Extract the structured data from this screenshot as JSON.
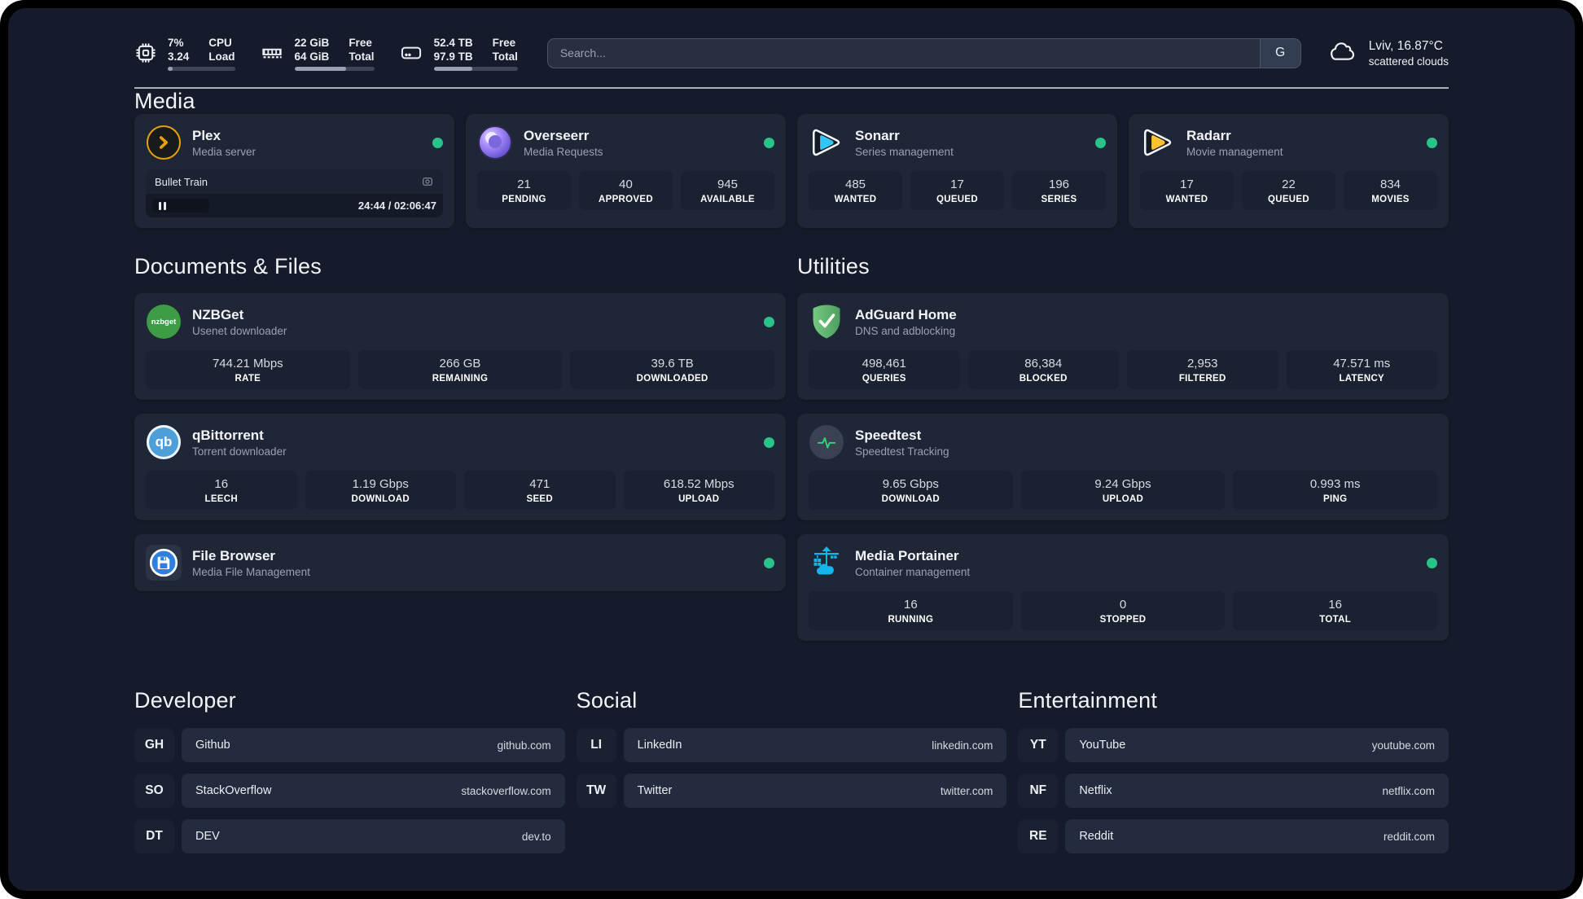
{
  "header": {
    "stats": [
      {
        "name": "cpu",
        "values": [
          "7%",
          "3.24"
        ],
        "labels": [
          "CPU",
          "Load"
        ],
        "percent": 7
      },
      {
        "name": "memory",
        "values": [
          "22 GiB",
          "64 GiB"
        ],
        "labels": [
          "Free",
          "Total"
        ],
        "percent": 65
      },
      {
        "name": "disk",
        "values": [
          "52.4 TB",
          "97.9 TB"
        ],
        "labels": [
          "Free",
          "Total"
        ],
        "percent": 46
      }
    ],
    "search": {
      "placeholder": "Search...",
      "engine": "G"
    },
    "weather": {
      "summary": "Lviv, 16.87°C",
      "condition": "scattered clouds"
    }
  },
  "media": {
    "title": "Media",
    "plex": {
      "name": "Plex",
      "subtitle": "Media server",
      "player": {
        "title": "Bullet Train",
        "time": "24:44 / 02:06:47",
        "progress_percent": 20,
        "state": "paused"
      }
    },
    "overseerr": {
      "name": "Overseerr",
      "subtitle": "Media Requests",
      "stats": [
        {
          "value": "21",
          "label": "PENDING"
        },
        {
          "value": "40",
          "label": "APPROVED"
        },
        {
          "value": "945",
          "label": "AVAILABLE"
        }
      ]
    },
    "sonarr": {
      "name": "Sonarr",
      "subtitle": "Series management",
      "stats": [
        {
          "value": "485",
          "label": "WANTED"
        },
        {
          "value": "17",
          "label": "QUEUED"
        },
        {
          "value": "196",
          "label": "SERIES"
        }
      ]
    },
    "radarr": {
      "name": "Radarr",
      "subtitle": "Movie management",
      "stats": [
        {
          "value": "17",
          "label": "WANTED"
        },
        {
          "value": "22",
          "label": "QUEUED"
        },
        {
          "value": "834",
          "label": "MOVIES"
        }
      ]
    }
  },
  "documents": {
    "title": "Documents & Files",
    "nzbget": {
      "name": "NZBGet",
      "subtitle": "Usenet downloader",
      "icon_text": "nzbget",
      "stats": [
        {
          "value": "744.21 Mbps",
          "label": "RATE"
        },
        {
          "value": "266 GB",
          "label": "REMAINING"
        },
        {
          "value": "39.6 TB",
          "label": "DOWNLOADED"
        }
      ]
    },
    "qbittorrent": {
      "name": "qBittorrent",
      "subtitle": "Torrent downloader",
      "icon_text": "qb",
      "stats": [
        {
          "value": "16",
          "label": "LEECH"
        },
        {
          "value": "1.19 Gbps",
          "label": "DOWNLOAD"
        },
        {
          "value": "471",
          "label": "SEED"
        },
        {
          "value": "618.52 Mbps",
          "label": "UPLOAD"
        }
      ]
    },
    "filebrowser": {
      "name": "File Browser",
      "subtitle": "Media File Management"
    }
  },
  "utilities": {
    "title": "Utilities",
    "adguard": {
      "name": "AdGuard Home",
      "subtitle": "DNS and adblocking",
      "stats": [
        {
          "value": "498,461",
          "label": "QUERIES"
        },
        {
          "value": "86,384",
          "label": "BLOCKED"
        },
        {
          "value": "2,953",
          "label": "FILTERED"
        },
        {
          "value": "47.571 ms",
          "label": "LATENCY"
        }
      ]
    },
    "speedtest": {
      "name": "Speedtest",
      "subtitle": "Speedtest Tracking",
      "stats": [
        {
          "value": "9.65 Gbps",
          "label": "DOWNLOAD"
        },
        {
          "value": "9.24 Gbps",
          "label": "UPLOAD"
        },
        {
          "value": "0.993 ms",
          "label": "PING"
        }
      ]
    },
    "portainer": {
      "name": "Media Portainer",
      "subtitle": "Container management",
      "stats": [
        {
          "value": "16",
          "label": "RUNNING"
        },
        {
          "value": "0",
          "label": "STOPPED"
        },
        {
          "value": "16",
          "label": "TOTAL"
        }
      ]
    }
  },
  "bookmarks": {
    "developer": {
      "title": "Developer",
      "links": [
        {
          "abbr": "GH",
          "name": "Github",
          "url": "github.com"
        },
        {
          "abbr": "SO",
          "name": "StackOverflow",
          "url": "stackoverflow.com"
        },
        {
          "abbr": "DT",
          "name": "DEV",
          "url": "dev.to"
        }
      ]
    },
    "social": {
      "title": "Social",
      "links": [
        {
          "abbr": "LI",
          "name": "LinkedIn",
          "url": "linkedin.com"
        },
        {
          "abbr": "TW",
          "name": "Twitter",
          "url": "twitter.com"
        }
      ]
    },
    "entertainment": {
      "title": "Entertainment",
      "links": [
        {
          "abbr": "YT",
          "name": "YouTube",
          "url": "youtube.com"
        },
        {
          "abbr": "NF",
          "name": "Netflix",
          "url": "netflix.com"
        },
        {
          "abbr": "RE",
          "name": "Reddit",
          "url": "reddit.com"
        }
      ]
    }
  },
  "colors": {
    "background": "#151B2B",
    "card": "#1F2737",
    "tile": "#1A2231",
    "status_online": "#29C289",
    "plex_gold": "#E5A00D",
    "sonarr_blue": "#35C5F4",
    "radarr_yellow": "#FFC230",
    "portainer_blue": "#13B5EA",
    "adguard_green": "#5FB86C"
  }
}
